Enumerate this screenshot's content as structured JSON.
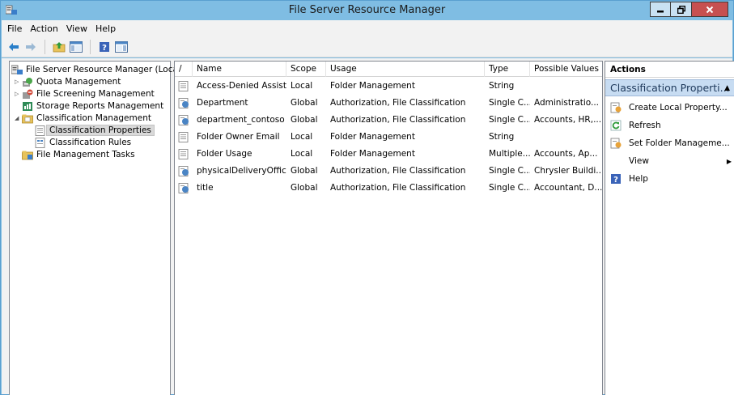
{
  "window": {
    "title": "File Server Resource Manager"
  },
  "menu": [
    "File",
    "Action",
    "View",
    "Help"
  ],
  "tree": {
    "root": "File Server Resource Manager (Local)",
    "items": [
      {
        "label": "Quota Management",
        "level": 1,
        "expander": "▷"
      },
      {
        "label": "File Screening Management",
        "level": 1,
        "expander": "▷"
      },
      {
        "label": "Storage Reports Management",
        "level": 1,
        "expander": ""
      },
      {
        "label": "Classification Management",
        "level": 1,
        "expander": "◢"
      },
      {
        "label": "Classification Properties",
        "level": 2,
        "expander": ""
      },
      {
        "label": "Classification Rules",
        "level": 2,
        "expander": ""
      },
      {
        "label": "File Management Tasks",
        "level": 1,
        "expander": ""
      }
    ]
  },
  "list": {
    "columns": {
      "sort": "/",
      "name": "Name",
      "scope": "Scope",
      "usage": "Usage",
      "type": "Type",
      "values": "Possible Values"
    },
    "rows": [
      {
        "name": "Access-Denied Assist...",
        "scope": "Local",
        "usage": "Folder Management",
        "type": "String",
        "values": "",
        "icon": "property-page-icon"
      },
      {
        "name": "Department",
        "scope": "Global",
        "usage": "Authorization, File Classification",
        "type": "Single C...",
        "values": "Administratio...",
        "icon": "global-property-icon"
      },
      {
        "name": "department_contoso",
        "scope": "Global",
        "usage": "Authorization, File Classification",
        "type": "Single C...",
        "values": "Accounts, HR,...",
        "icon": "global-property-icon"
      },
      {
        "name": "Folder Owner Email",
        "scope": "Local",
        "usage": "Folder Management",
        "type": "String",
        "values": "",
        "icon": "property-page-icon"
      },
      {
        "name": "Folder Usage",
        "scope": "Local",
        "usage": "Folder Management",
        "type": "Multiple...",
        "values": "Accounts, Ap...",
        "icon": "property-page-icon"
      },
      {
        "name": "physicalDeliveryOffic...",
        "scope": "Global",
        "usage": "Authorization, File Classification",
        "type": "Single C...",
        "values": "Chrysler Buildi...",
        "icon": "global-property-icon"
      },
      {
        "name": "title",
        "scope": "Global",
        "usage": "Authorization, File Classification",
        "type": "Single C...",
        "values": "Accountant, D...",
        "icon": "global-property-icon"
      }
    ]
  },
  "actions": {
    "header": "Actions",
    "section": "Classification Properti...",
    "items": [
      {
        "label": "Create Local Property...",
        "icon": "create-property-icon"
      },
      {
        "label": "Refresh",
        "icon": "refresh-icon"
      },
      {
        "label": "Set Folder Manageme...",
        "icon": "folder-management-icon"
      },
      {
        "label": "View",
        "icon": ""
      },
      {
        "label": "Help",
        "icon": "help-icon"
      }
    ]
  },
  "colors": {
    "titlebar": "#7fbde3",
    "section": "#c7dcf2",
    "close": "#c75050"
  }
}
